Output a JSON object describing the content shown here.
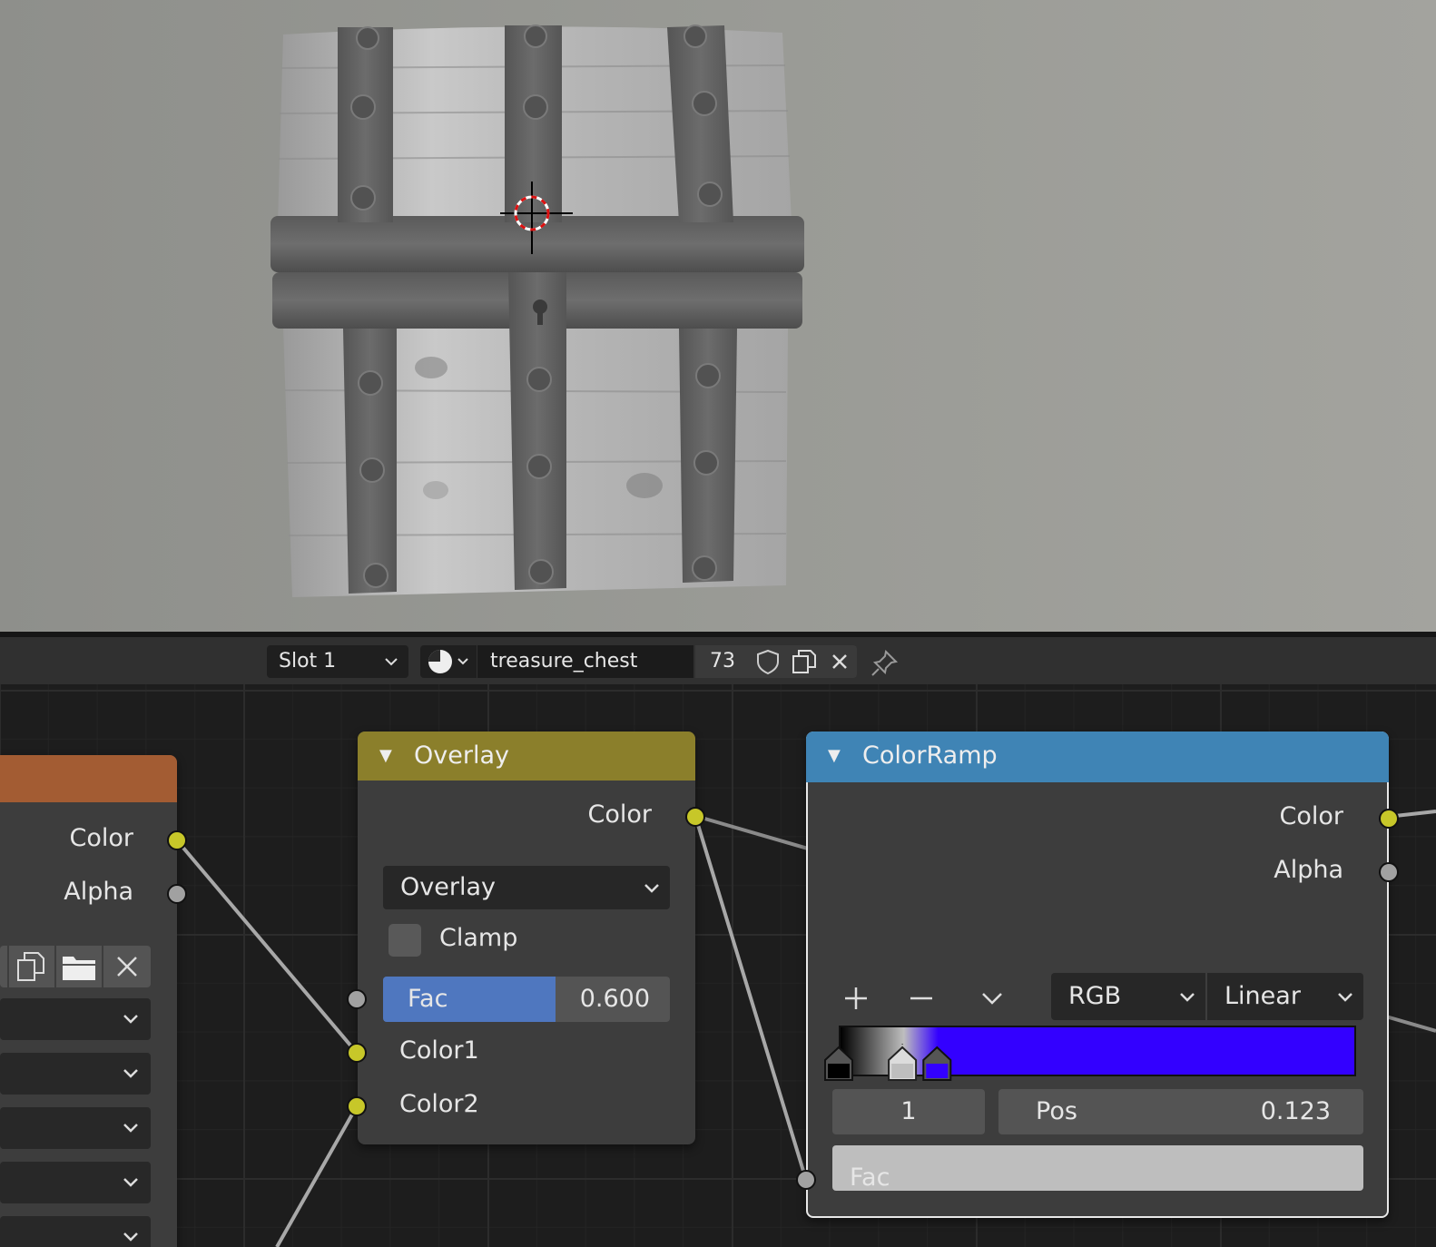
{
  "header": {
    "slot": "Slot 1",
    "material_name": "treasure_chest",
    "users_count": "73"
  },
  "image_node": {
    "outputs": [
      "Color",
      "Alpha"
    ]
  },
  "overlay_node": {
    "title": "Overlay",
    "output": "Color",
    "blend_mode": "Overlay",
    "clamp_label": "Clamp",
    "clamp_checked": false,
    "fac_label": "Fac",
    "fac_value": "0.600",
    "fac_fraction": 0.6,
    "inputs": [
      "Color1",
      "Color2"
    ]
  },
  "colorramp_node": {
    "title": "ColorRamp",
    "outputs": [
      "Color",
      "Alpha"
    ],
    "color_mode": "RGB",
    "interpolation": "Linear",
    "stop_index": "1",
    "pos_label": "Pos",
    "pos_value": "0.123",
    "input": "Fac",
    "stops": [
      {
        "pos": 0.0,
        "color": "#000000"
      },
      {
        "pos": 0.123,
        "color": "#bebebe"
      },
      {
        "pos": 0.19,
        "color": "#3300ff"
      }
    ],
    "active_stop_color": "#bebebe"
  },
  "colors": {
    "overlay_header": "#8b7f2b",
    "colorramp_header": "#3f84b5",
    "image_header": "#a35c33",
    "socket_color": "#c7c729",
    "socket_float": "#a1a1a1",
    "fac_fill": "#4f77bf"
  },
  "icons": [
    "chevron-down-icon",
    "material-browse-icon",
    "fake-user-shield-icon",
    "duplicate-icon",
    "close-icon",
    "pin-icon",
    "folder-icon",
    "plus-icon",
    "minus-icon",
    "collapse-triangle-icon"
  ]
}
